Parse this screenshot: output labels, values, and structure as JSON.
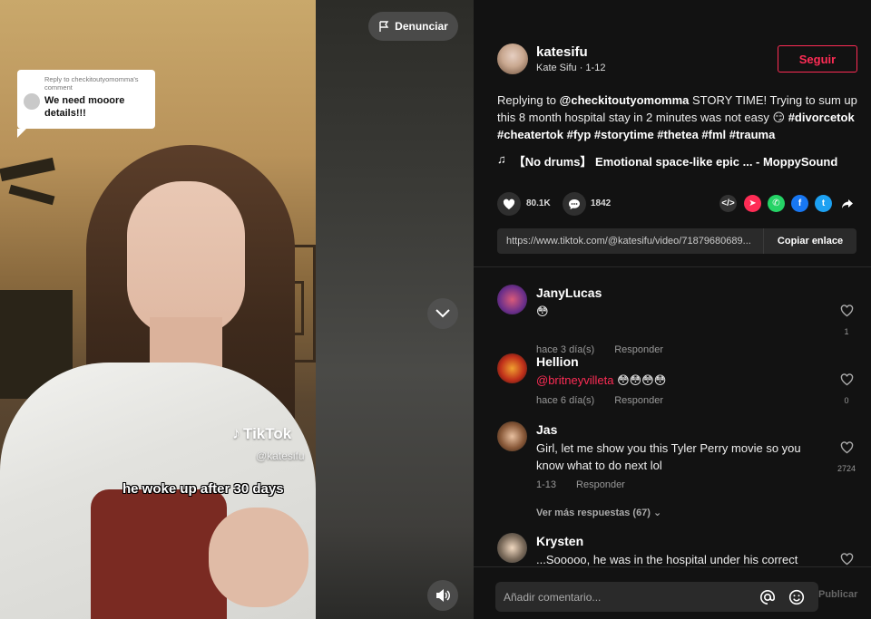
{
  "video": {
    "reply_sticker": {
      "reply_to": "Reply to checkitoutyomomma's comment",
      "text": "We need mooore details!!!"
    },
    "watermark_brand": "TikTok",
    "watermark_user": "@katesifu",
    "caption": "he woke up after 30 days",
    "report_label": "Denunciar"
  },
  "author": {
    "handle": "katesifu",
    "name_date": "Kate Sifu · 1-12",
    "follow_label": "Seguir"
  },
  "description": {
    "prefix": "Replying to",
    "mention": "@checkitoutyomomma",
    "text": "STORY TIME! Trying to sum up this 8 month hospital stay in 2 minutes was not easy",
    "emoji": "😏",
    "hashtags": "#divorcetok #cheatertok #fyp #storytime #thetea #fml #trauma"
  },
  "music": {
    "icon": "music-note-icon",
    "title": "【No drums】 Emotional space-like epic ... - MoppySound"
  },
  "stats": {
    "likes": "80.1K",
    "comments": "1842"
  },
  "share": {
    "url": "https://www.tiktok.com/@katesifu/video/71879680689...",
    "copy_label": "Copiar enlace",
    "colors": {
      "embed": "#333333",
      "direct": "#fe2c55",
      "whatsapp": "#25d366",
      "facebook": "#1877f2",
      "twitter": "#1da1f2"
    }
  },
  "comments": [
    {
      "name": "JanyLucas",
      "text": "😳",
      "meta_time": "hace 3 día(s)",
      "reply": "Responder",
      "likes": "1"
    },
    {
      "name": "Hellion",
      "mention": "@britneyvilleta",
      "text": "😳😳😳😳",
      "meta_time": "hace 6 día(s)",
      "reply": "Responder",
      "likes": "0"
    },
    {
      "name": "Jas",
      "text": "Girl, let me show you this Tyler Perry movie so you know what to do next lol",
      "meta_time": "1-13",
      "reply": "Responder",
      "likes": "2724",
      "more": "Ver más respuestas (67)"
    },
    {
      "name": "Krysten",
      "text": "...Sooooo, he was in the hospital under his correct",
      "likes": ""
    }
  ],
  "input": {
    "placeholder": "Añadir comentario...",
    "publish_label": "Publicar"
  },
  "accent": "#fe2c55"
}
